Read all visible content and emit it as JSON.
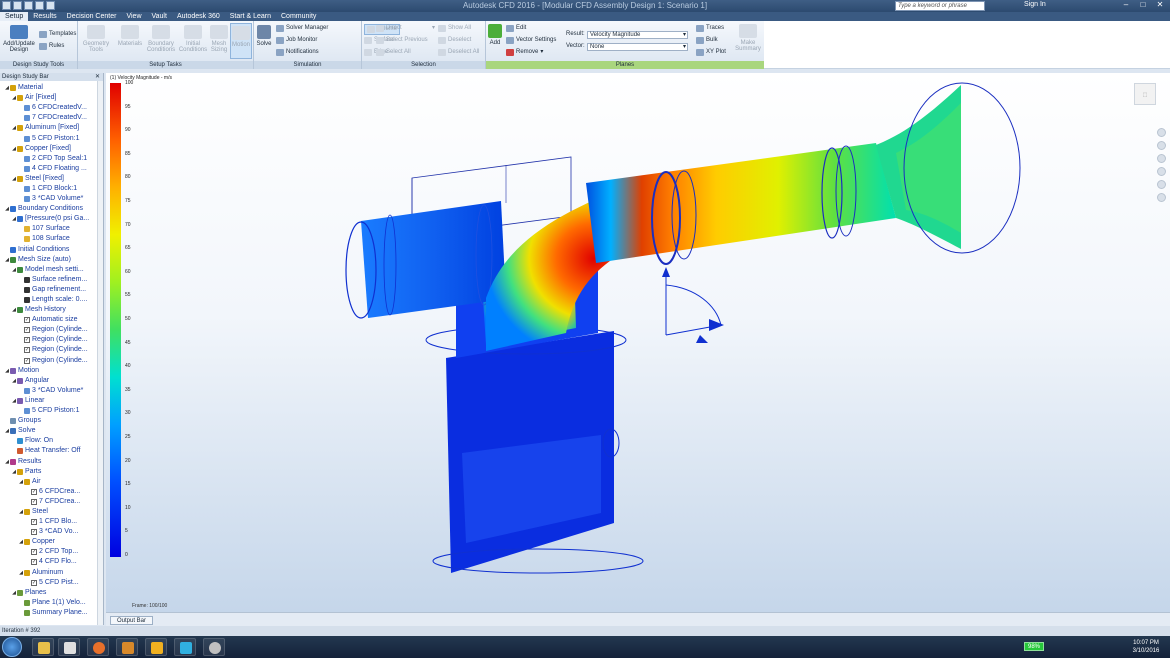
{
  "titlebar": {
    "title": "Autodesk CFD 2016 - [Modular CFD Assembly Design 1: Scenario 1]",
    "search_placeholder": "Type a keyword or phrase",
    "sign_in": "Sign In"
  },
  "tabs": [
    "Setup",
    "Results",
    "Decision Center",
    "View",
    "Vault",
    "Autodesk 360",
    "Start & Learn",
    "Community"
  ],
  "ribbon": {
    "design_study_tools": {
      "label": "Design Study Tools",
      "add_update": "Add/Update Design",
      "templates": "Templates",
      "rules": "Rules"
    },
    "setup_tasks": {
      "label": "Setup Tasks",
      "geometry_tools": "Geometry Tools",
      "materials": "Materials",
      "boundary_conditions": "Boundary Conditions",
      "initial_conditions": "Initial Conditions",
      "mesh_sizing": "Mesh Sizing",
      "motion": "Motion"
    },
    "simulation": {
      "label": "Simulation",
      "solve": "Solve",
      "solver_manager": "Solver Manager",
      "job_monitor": "Job Monitor",
      "notifications": "Notifications"
    },
    "selection": {
      "label": "Selection",
      "volume": "Volume",
      "surface": "Surface",
      "edge": "Edge",
      "direct": "Direct",
      "select_previous": "Select Previous",
      "select_all": "Select All",
      "show_all": "Show All",
      "deselect": "Deselect",
      "deselect_all": "Deselect All"
    },
    "planes": {
      "label": "Planes",
      "add": "Add",
      "edit": "Edit",
      "vector_settings": "Vector Settings",
      "remove": "Remove",
      "result_label": "Result:",
      "result_value": "Velocity Magnitude",
      "vector_label": "Vector:",
      "vector_value": "None",
      "traces": "Traces",
      "bulk": "Bulk",
      "xy_plot": "XY Plot",
      "make_summary": "Make Summary"
    }
  },
  "design_study_bar": {
    "title": "Design Study Bar",
    "items": [
      {
        "text": "Material",
        "indent": 1,
        "exp": "◢",
        "color": "#d4a10a"
      },
      {
        "text": "Air [Fixed]",
        "indent": 2,
        "exp": "◢",
        "color": "#d4a10a"
      },
      {
        "text": "6 CFDCreatedV...",
        "indent": 3,
        "color": "#5d8fd4"
      },
      {
        "text": "7 CFDCreatedV...",
        "indent": 3,
        "color": "#5d8fd4"
      },
      {
        "text": "Aluminum [Fixed]",
        "indent": 2,
        "exp": "◢",
        "color": "#d4a10a"
      },
      {
        "text": "5 CFD Piston:1",
        "indent": 3,
        "color": "#5d8fd4"
      },
      {
        "text": "Copper [Fixed]",
        "indent": 2,
        "exp": "◢",
        "color": "#d4a10a"
      },
      {
        "text": "2 CFD Top Seal:1",
        "indent": 3,
        "color": "#5d8fd4"
      },
      {
        "text": "4 CFD Floating ...",
        "indent": 3,
        "color": "#5d8fd4"
      },
      {
        "text": "Steel [Fixed]",
        "indent": 2,
        "exp": "◢",
        "color": "#d4a10a"
      },
      {
        "text": "1 CFD Block:1",
        "indent": 3,
        "color": "#5d8fd4"
      },
      {
        "text": "3 *CAD Volume*",
        "indent": 3,
        "color": "#5d8fd4"
      },
      {
        "text": "Boundary Conditions",
        "indent": 1,
        "exp": "◢",
        "color": "#2f6fd0"
      },
      {
        "text": "[Pressure(0 psi Ga...",
        "indent": 2,
        "exp": "◢",
        "color": "#2f6fd0"
      },
      {
        "text": "107 Surface",
        "indent": 3,
        "color": "#e2b230"
      },
      {
        "text": "108 Surface",
        "indent": 3,
        "color": "#e2b230"
      },
      {
        "text": "Initial Conditions",
        "indent": 1,
        "color": "#2f6fd0"
      },
      {
        "text": "Mesh Size (auto)",
        "indent": 1,
        "exp": "◢",
        "color": "#3d8a3d"
      },
      {
        "text": "Model mesh setti...",
        "indent": 2,
        "exp": "◢",
        "color": "#3d8a3d"
      },
      {
        "text": "Surface refinem...",
        "indent": 3,
        "color": "#333333"
      },
      {
        "text": "Gap refinement...",
        "indent": 3,
        "color": "#333333"
      },
      {
        "text": "Length scale: 0....",
        "indent": 3,
        "color": "#333333"
      },
      {
        "text": "Mesh History",
        "indent": 2,
        "exp": "◢",
        "color": "#3d8a3d"
      },
      {
        "text": "Automatic size",
        "indent": 3,
        "check": true
      },
      {
        "text": "Region (Cylinde...",
        "indent": 3,
        "check": true
      },
      {
        "text": "Region (Cylinde...",
        "indent": 3,
        "check": true
      },
      {
        "text": "Region (Cylinde...",
        "indent": 3,
        "check": true
      },
      {
        "text": "Region (Cylinde...",
        "indent": 3,
        "check": true
      },
      {
        "text": "Motion",
        "indent": 1,
        "exp": "◢",
        "color": "#7a5bb0"
      },
      {
        "text": "Angular",
        "indent": 2,
        "exp": "◢",
        "color": "#7a5bb0"
      },
      {
        "text": "3 *CAD Volume*",
        "indent": 3,
        "color": "#5d8fd4"
      },
      {
        "text": "Linear",
        "indent": 2,
        "exp": "◢",
        "color": "#7a5bb0"
      },
      {
        "text": "5 CFD Piston:1",
        "indent": 3,
        "color": "#5d8fd4"
      },
      {
        "text": "Groups",
        "indent": 1,
        "color": "#6f8fb0"
      },
      {
        "text": "Solve",
        "indent": 1,
        "exp": "◢",
        "color": "#3a6fb8"
      },
      {
        "text": "Flow: On",
        "indent": 2,
        "color": "#2f8fd0"
      },
      {
        "text": "Heat Transfer: Off",
        "indent": 2,
        "color": "#d05a2f"
      },
      {
        "text": "Results",
        "indent": 1,
        "exp": "◢",
        "color": "#b03a8a"
      },
      {
        "text": "Parts",
        "indent": 2,
        "exp": "◢",
        "color": "#d4a10a"
      },
      {
        "text": "Air",
        "indent": 3,
        "exp": "◢",
        "color": "#d4a10a"
      },
      {
        "text": "6 CFDCrea...",
        "indent": 4,
        "check": true
      },
      {
        "text": "7 CFDCrea...",
        "indent": 4,
        "check": true
      },
      {
        "text": "Steel",
        "indent": 3,
        "exp": "◢",
        "color": "#d4a10a"
      },
      {
        "text": "1 CFD Blo...",
        "indent": 4,
        "check": true
      },
      {
        "text": "3 *CAD Vo...",
        "indent": 4,
        "check": true
      },
      {
        "text": "Copper",
        "indent": 3,
        "exp": "◢",
        "color": "#d4a10a"
      },
      {
        "text": "2 CFD Top...",
        "indent": 4,
        "check": true
      },
      {
        "text": "4 CFD Flo...",
        "indent": 4,
        "check": true
      },
      {
        "text": "Aluminum",
        "indent": 3,
        "exp": "◢",
        "color": "#d4a10a"
      },
      {
        "text": "5 CFD Pist...",
        "indent": 4,
        "check": true
      },
      {
        "text": "Planes",
        "indent": 2,
        "exp": "◢",
        "color": "#6a9a3a"
      },
      {
        "text": "Plane 1(1) Velo...",
        "indent": 3,
        "color": "#6a9a3a"
      },
      {
        "text": "Summary Plane...",
        "indent": 3,
        "color": "#6a9a3a"
      }
    ]
  },
  "viewport": {
    "legend_title": "(1) Velocity Magnitude - m/s",
    "legend_ticks": [
      "100",
      "95",
      "90",
      "85",
      "80",
      "75",
      "70",
      "65",
      "60",
      "55",
      "50",
      "45",
      "40",
      "35",
      "30",
      "25",
      "20",
      "15",
      "10",
      "5",
      "0"
    ],
    "frame": "Frame: 100/100"
  },
  "output_bar": {
    "label": "Output Bar"
  },
  "status": {
    "text": "Iteration # 392"
  },
  "taskbar": {
    "battery": "98%",
    "time": "10:07 PM",
    "date": "3/10/2016"
  }
}
